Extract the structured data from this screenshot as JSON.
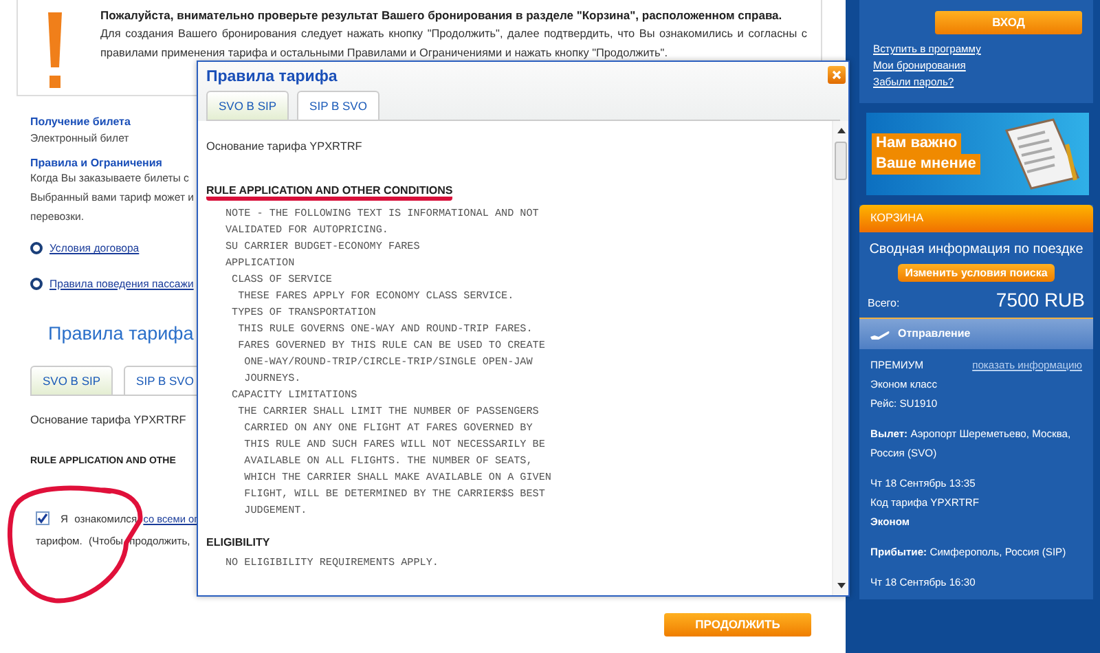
{
  "notice": {
    "title": "Пожалуйста, внимательно проверьте результат Вашего бронирования в разделе \"Корзина\", расположенном справа.",
    "text": "Для создания Вашего бронирования следует нажать кнопку \"Продолжить\", далее подтвердить, что Вы ознакомились и согласны с правилами применения тарифа и остальными Правилами и Ограничениями и нажать кнопку \"Продолжить\"."
  },
  "sections": [
    {
      "title": "Получение билета",
      "lines": [
        "Электронный билет"
      ]
    },
    {
      "title": "Правила и Ограничения",
      "lines": [
        "Когда Вы заказываете билеты с",
        "Выбранный вами тариф может и",
        "перевозки."
      ]
    }
  ],
  "links": [
    "Условия договора",
    "Правила поведения пассажи"
  ],
  "fare_rules": {
    "heading": "Правила тарифа",
    "tabs": [
      {
        "label": "SVO B SIP",
        "selected": true
      },
      {
        "label": "SIP B SVO",
        "selected": false
      }
    ],
    "basis": "Основание тарифа YPXRTRF",
    "rule_heading": "RULE APPLICATION AND OTHE"
  },
  "agreement": {
    "checked": true,
    "circled": true,
    "text": "Я ознакомился",
    "link": "со всеми ог",
    "line2": "тарифом. (Чтобы продолжить,"
  },
  "continue_button": "ПРОДОЛЖИТЬ",
  "modal": {
    "title": "Правила тарифа",
    "tabs": [
      {
        "label": "SVO B SIP",
        "selected": true
      },
      {
        "label": "SIP B SVO",
        "selected": false
      }
    ],
    "basis": "Основание тарифа YPXRTRF",
    "sections": [
      {
        "heading": "RULE APPLICATION AND OTHER CONDITIONS",
        "underlined": true,
        "lines": [
          "NOTE - THE FOLLOWING TEXT IS INFORMATIONAL AND NOT",
          "VALIDATED FOR AUTOPRICING.",
          "SU CARRIER BUDGET-ECONOMY FARES",
          "APPLICATION",
          " CLASS OF SERVICE",
          "  THESE FARES APPLY FOR ECONOMY CLASS SERVICE.",
          " TYPES OF TRANSPORTATION",
          "  THIS RULE GOVERNS ONE-WAY AND ROUND-TRIP FARES.",
          "  FARES GOVERNED BY THIS RULE CAN BE USED TO CREATE",
          "   ONE-WAY/ROUND-TRIP/CIRCLE-TRIP/SINGLE OPEN-JAW",
          "   JOURNEYS.",
          " CAPACITY LIMITATIONS",
          "  THE CARRIER SHALL LIMIT THE NUMBER OF PASSENGERS",
          "   CARRIED ON ANY ONE FLIGHT AT FARES GOVERNED BY",
          "   THIS RULE AND SUCH FARES WILL NOT NECESSARILY BE",
          "   AVAILABLE ON ALL FLIGHTS. THE NUMBER OF SEATS,",
          "   WHICH THE CARRIER SHALL MAKE AVAILABLE ON A GIVEN",
          "   FLIGHT, WILL BE DETERMINED BY THE CARRIER$S BEST",
          "   JUDGEMENT."
        ]
      },
      {
        "heading": "ELIGIBILITY",
        "underlined": false,
        "lines": [
          "NO ELIGIBILITY REQUIREMENTS APPLY."
        ]
      }
    ]
  },
  "sidebar": {
    "login_button": "ВХОД",
    "links": [
      "Вступить в программу",
      "Мои бронирования",
      "Забыли пароль?"
    ],
    "banner": [
      "Нам важно",
      "Ваше мнение"
    ],
    "basket": {
      "header": "КОРЗИНА",
      "summary": "Сводная информация по поездке",
      "button": "Изменить условия поиска",
      "total_label": "Всего:",
      "total": "7500 RUB"
    },
    "departure": {
      "header": "Отправление",
      "fare": "ПРЕМИУМ",
      "info_link": "показать информацию",
      "lines": [
        "Эконом класс",
        "Рейс: SU1910",
        "**Вылет:** Аэропорт Шереметьево, Москва, Россия (SVO)",
        "Чт 18 Сентябрь 13:35",
        "Код тарифа YPXRTRF",
        "**Эконом**",
        "**Прибытие:** Симферополь, Россия (SIP)",
        "Чт 18 Сентябрь 16:30"
      ]
    }
  }
}
